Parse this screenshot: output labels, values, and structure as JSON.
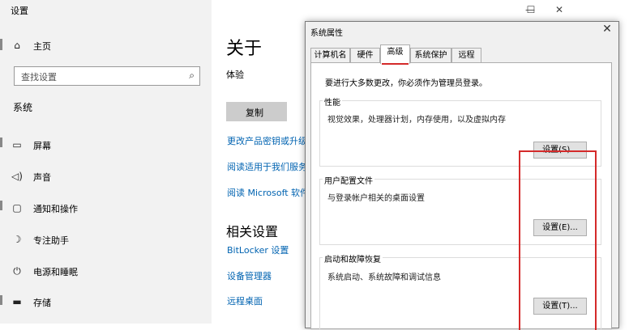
{
  "settings": {
    "title": "设置",
    "home": "主页",
    "search_placeholder": "查找设置",
    "section": "系统",
    "nav": [
      "屏幕",
      "声音",
      "通知和操作",
      "专注助手",
      "电源和睡眠",
      "存储"
    ],
    "icons": [
      "home-icon",
      "search-icon",
      "display-icon",
      "sound-icon",
      "notification-icon",
      "focus-assist-icon",
      "power-icon",
      "storage-icon"
    ],
    "main": {
      "heading": "关于",
      "subheading": "体验",
      "copy_button": "复制",
      "links": [
        "更改产品密钥或升级",
        "阅读适用于我们服务",
        "阅读 Microsoft 软件"
      ],
      "related_heading": "相关设置",
      "related_links": [
        "BitLocker 设置",
        "设备管理器",
        "远程桌面"
      ]
    },
    "window_controls": [
      "—",
      "☐",
      "✕"
    ]
  },
  "dialog": {
    "title": "系统属性",
    "close": "✕",
    "tabs": [
      "计算机名",
      "硬件",
      "高级",
      "系统保护",
      "远程"
    ],
    "active_tab": "高级",
    "admin_note": "要进行大多数更改，你必须作为管理员登录。",
    "groups": [
      {
        "label": "性能",
        "text": "视觉效果，处理器计划，内存使用，以及虚拟内存",
        "button": "设置(S)..."
      },
      {
        "label": "用户配置文件",
        "text": "与登录帐户相关的桌面设置",
        "button": "设置(E)..."
      },
      {
        "label": "启动和故障恢复",
        "text": "系统启动、系统故障和调试信息",
        "button": "设置(T)..."
      }
    ]
  },
  "colors": {
    "link": "#0063b1",
    "highlight": "#d42a2a"
  }
}
